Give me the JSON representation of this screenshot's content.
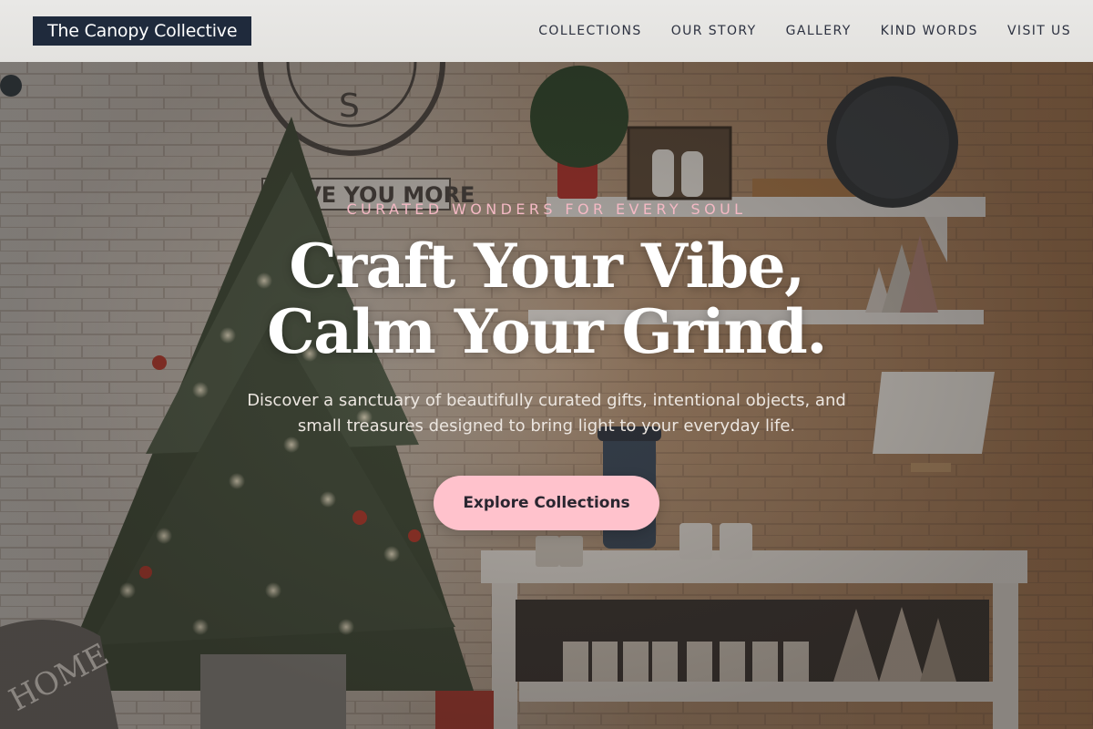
{
  "brand": {
    "name": "The Canopy Collective"
  },
  "nav": {
    "items": [
      {
        "label": "COLLECTIONS"
      },
      {
        "label": "OUR STORY"
      },
      {
        "label": "GALLERY"
      },
      {
        "label": "KIND WORDS"
      },
      {
        "label": "VISIT US"
      }
    ]
  },
  "hero": {
    "eyebrow": "CURATED WONDERS FOR EVERY SOUL",
    "headline_line1": "Craft Your Vibe,",
    "headline_line2": "Calm Your Grind.",
    "lede": "Discover a sanctuary of beautifully curated gifts, intentional objects, and small treasures designed to bring light to your everyday life.",
    "cta_label": "Explore Collections",
    "background": {
      "sign_text": "LOVE YOU MORE",
      "pillow_text": "HOME"
    }
  },
  "colors": {
    "logo_bg": "#1f2a3c",
    "header_bg": "#e6e5e2",
    "nav_text": "#2c3140",
    "eyebrow": "#f4b9c4",
    "cta_bg": "#ffc2cc",
    "cta_text": "#2a2630"
  }
}
